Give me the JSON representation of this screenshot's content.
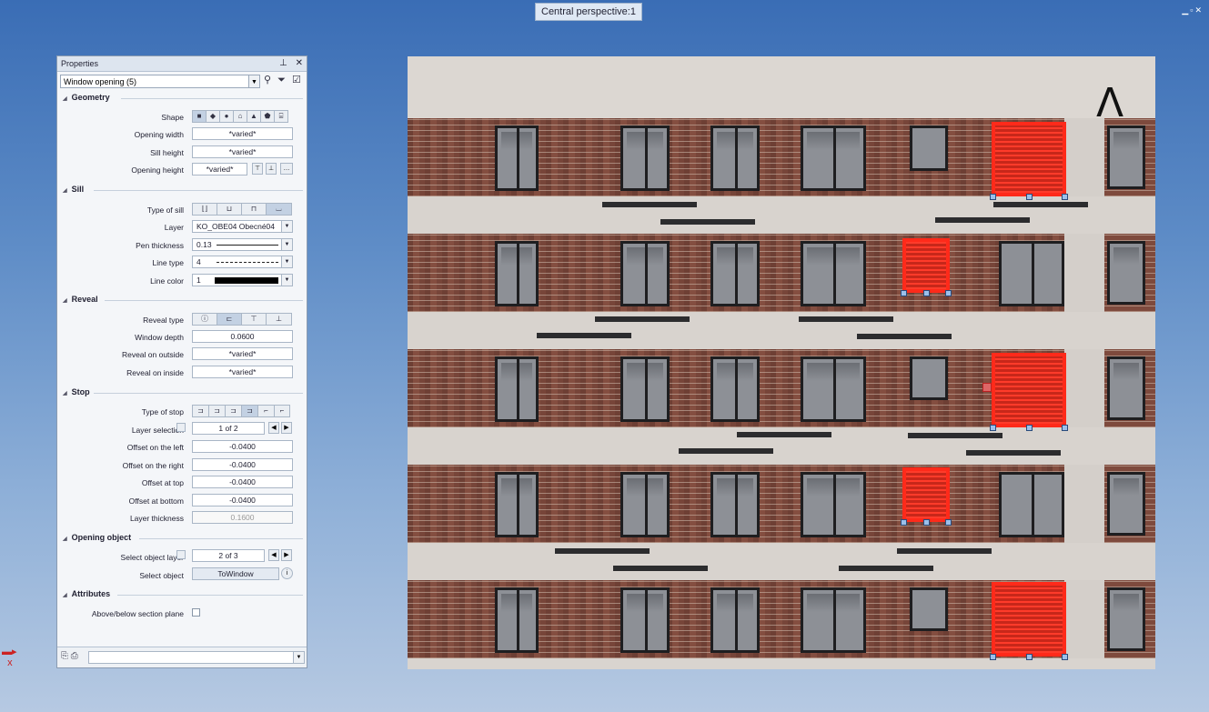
{
  "viewport": {
    "tab_label": "Central perspective:1"
  },
  "panel": {
    "title": "Properties",
    "object_select": "Window opening (5)",
    "sections": {
      "geometry": "Geometry",
      "sill": "Sill",
      "reveal": "Reveal",
      "stop": "Stop",
      "opening_object": "Opening object",
      "attributes": "Attributes"
    },
    "geometry": {
      "shape_label": "Shape",
      "opening_width_label": "Opening width",
      "opening_width": "*varied*",
      "sill_height_label": "Sill height",
      "sill_height": "*varied*",
      "opening_height_label": "Opening height",
      "opening_height": "*varied*"
    },
    "sill": {
      "type_label": "Type of sill",
      "layer_label": "Layer",
      "layer_value": "KO_OBE04  Obecné04",
      "pen_label": "Pen thickness",
      "pen_value": "0.13",
      "linetype_label": "Line type",
      "linetype_value": "4",
      "linecolor_label": "Line color",
      "linecolor_value": "1"
    },
    "reveal": {
      "type_label": "Reveal type",
      "depth_label": "Window depth",
      "depth_value": "0.0600",
      "outside_label": "Reveal on outside",
      "outside_value": "*varied*",
      "inside_label": "Reveal on inside",
      "inside_value": "*varied*"
    },
    "stop": {
      "type_label": "Type of stop",
      "layer_sel_label": "Layer selection",
      "layer_sel_value": "1 of 2",
      "left_label": "Offset on the left",
      "left_value": "-0.0400",
      "right_label": "Offset on the right",
      "right_value": "-0.0400",
      "top_label": "Offset at top",
      "top_value": "-0.0400",
      "bottom_label": "Offset at bottom",
      "bottom_value": "-0.0400",
      "thickness_label": "Layer thickness",
      "thickness_value": "0.1600"
    },
    "opening_object": {
      "layer_label": "Select object layer",
      "layer_value": "2 of 3",
      "object_label": "Select object",
      "object_value": "ToWindow"
    },
    "attributes": {
      "section_plane_label": "Above/below section plane"
    }
  },
  "colors": {
    "selection": "#ff2a1a",
    "background": "#4f7fc0"
  }
}
